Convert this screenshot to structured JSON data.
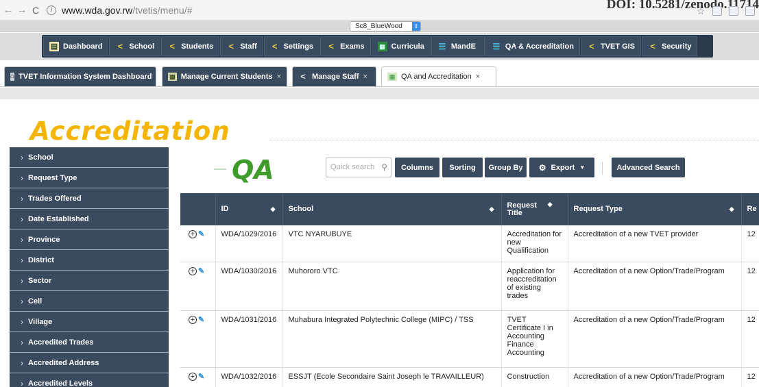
{
  "browser": {
    "host": "www.wda.gov.rw",
    "path": "/tvetis/menu/#",
    "doi_overlay": "DOI: 10.5281/zenodo.11714",
    "back_glyph": "←",
    "forward_glyph": "→",
    "reload_glyph": "C",
    "info_glyph": "i"
  },
  "theme_selector": {
    "value": "Sc8_BlueWood"
  },
  "menu": [
    {
      "label": "Dashboard",
      "icon": "document-icon"
    },
    {
      "label": "School",
      "icon": "share-icon"
    },
    {
      "label": "Students",
      "icon": "share-icon"
    },
    {
      "label": "Staff",
      "icon": "share-icon"
    },
    {
      "label": "Settings",
      "icon": "share-icon"
    },
    {
      "label": "Exams",
      "icon": "share-icon"
    },
    {
      "label": "Curricula",
      "icon": "grid-icon"
    },
    {
      "label": "MandE",
      "icon": "list-icon"
    },
    {
      "label": "QA & Accreditation",
      "icon": "list-icon"
    },
    {
      "label": "TVET GIS",
      "icon": "share-icon"
    },
    {
      "label": "Security",
      "icon": "share-icon"
    }
  ],
  "tabs": [
    {
      "label": "TVET Information System Dashboard",
      "closable": false
    },
    {
      "label": "Manage Current Students",
      "closable": true
    },
    {
      "label": "Manage Staff",
      "closable": true
    },
    {
      "label": "QA and Accreditation",
      "closable": true
    }
  ],
  "close_glyph": "×",
  "page": {
    "accreditation_title": "Accreditation",
    "qa_title": "QA"
  },
  "sidebar": [
    "School",
    "Request Type",
    "Trades Offered",
    "Date Established",
    "Province",
    "District",
    "Sector",
    "Cell",
    "Village",
    "Accredited Trades",
    "Accredited Address",
    "Accredited Levels"
  ],
  "toolbar": {
    "search_placeholder": "Quick search",
    "columns": "Columns",
    "sorting": "Sorting",
    "group_by": "Group By",
    "export": "Export",
    "advanced_search": "Advanced Search"
  },
  "table": {
    "headers": {
      "id": "ID",
      "school": "School",
      "request_title_1": "Request",
      "request_title_2": "Title",
      "request_type": "Request Type",
      "next": "Re"
    },
    "rows": [
      {
        "id": "WDA/1029/2016",
        "school": "VTC NYARUBUYE",
        "title": "Accreditation for new Qualification",
        "type": "Accreditation of a new TVET provider",
        "next": "12"
      },
      {
        "id": "WDA/1030/2016",
        "school": "Muhororo VTC",
        "title": "Application for reaccreditation of existing trades",
        "type": "Accreditation of a new Option/Trade/Program",
        "next": "12"
      },
      {
        "id": "WDA/1031/2016",
        "school": "Muhabura Integrated Polytechnic College (MIPC) / TSS",
        "title": "TVET Certificate I in Accounting Finance Accounting",
        "type": "Accreditation of a new Option/Trade/Program",
        "next": "12"
      },
      {
        "id": "WDA/1032/2016",
        "school": "ESSJT (Ecole Secondaire Saint Joseph le TRAVAILLEUR)",
        "title": "Construction",
        "type": "Accreditation of a new Option/Trade/Program",
        "next": "12"
      }
    ]
  },
  "colors": {
    "menu_bg": "#2a3a4d",
    "menu_item": "#394b60",
    "accreditation_title": "#f5b400",
    "qa_title": "#3f9c2a",
    "edit_icon": "#2d8fd6"
  }
}
